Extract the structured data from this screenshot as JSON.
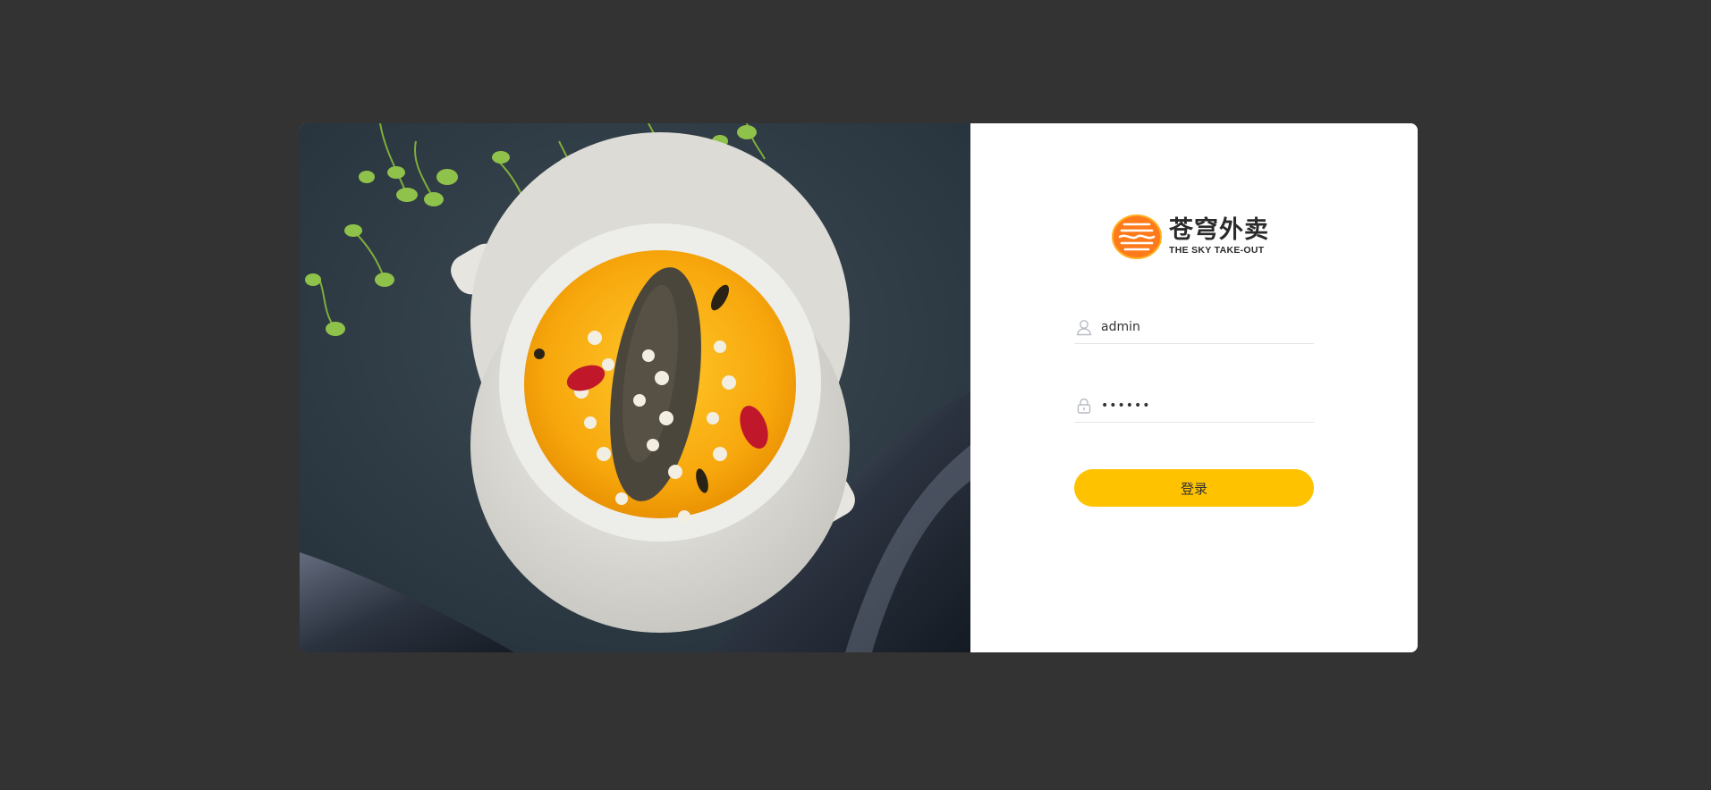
{
  "logo": {
    "cn": "苍穹外卖",
    "en": "THE SKY TAKE-OUT",
    "brand_color": "#ff7a1a"
  },
  "login_form": {
    "username": {
      "value": "admin",
      "icon": "user-icon"
    },
    "password": {
      "value": "123456",
      "icon": "lock-icon"
    },
    "submit_label": "登录"
  },
  "colors": {
    "page_background": "#333333",
    "card_background": "#ffffff",
    "button_background": "#ffc200"
  },
  "hero": {
    "icon": "food-photo"
  }
}
